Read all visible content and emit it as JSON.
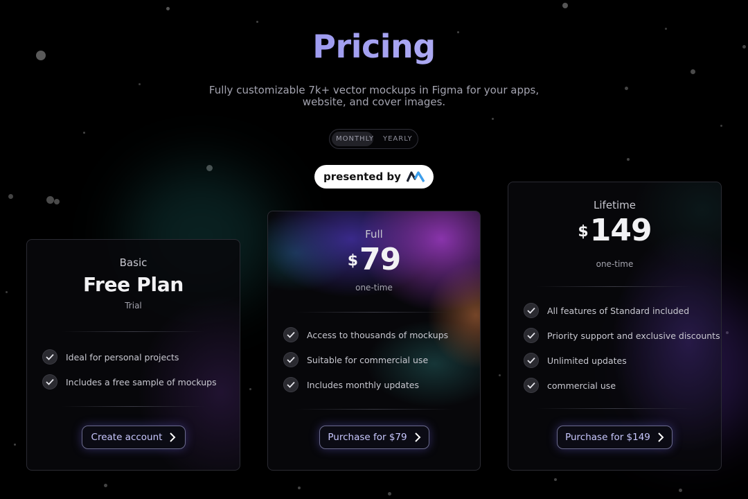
{
  "header": {
    "title": "Pricing",
    "subtitle_line1": "Fully customizable 7k+ vector mockups in Figma for your apps,",
    "subtitle_line2": "website, and cover images."
  },
  "billing_toggle": {
    "options": [
      "MONTHLY",
      "YEARLY"
    ],
    "selected": "MONTHLY"
  },
  "sponsor": {
    "label": "presented by",
    "logo_icon": "m-logo-icon"
  },
  "plans": [
    {
      "name": "Basic",
      "price_text": "Free Plan",
      "period": "Trial",
      "features": [
        "Ideal for personal projects",
        "Includes a free sample of mockups"
      ],
      "cta": "Create account"
    },
    {
      "name": "Full",
      "currency": "$",
      "price": "79",
      "period": "one-time",
      "features": [
        "Access to thousands of mockups",
        "Suitable for commercial use",
        "Includes monthly updates"
      ],
      "cta": "Purchase for $79"
    },
    {
      "name": "Lifetime",
      "currency": "$",
      "price": "149",
      "period": "one-time",
      "features": [
        "All features of Standard included",
        "Priority support and exclusive discounts",
        "Unlimited updates",
        "commercial use"
      ],
      "cta": "Purchase for $149"
    }
  ],
  "colors": {
    "background": "#000000",
    "title_gradient_start": "#7b78e8",
    "title_gradient_end": "#dcdcf6",
    "cta_text": "#c9c8ff"
  }
}
